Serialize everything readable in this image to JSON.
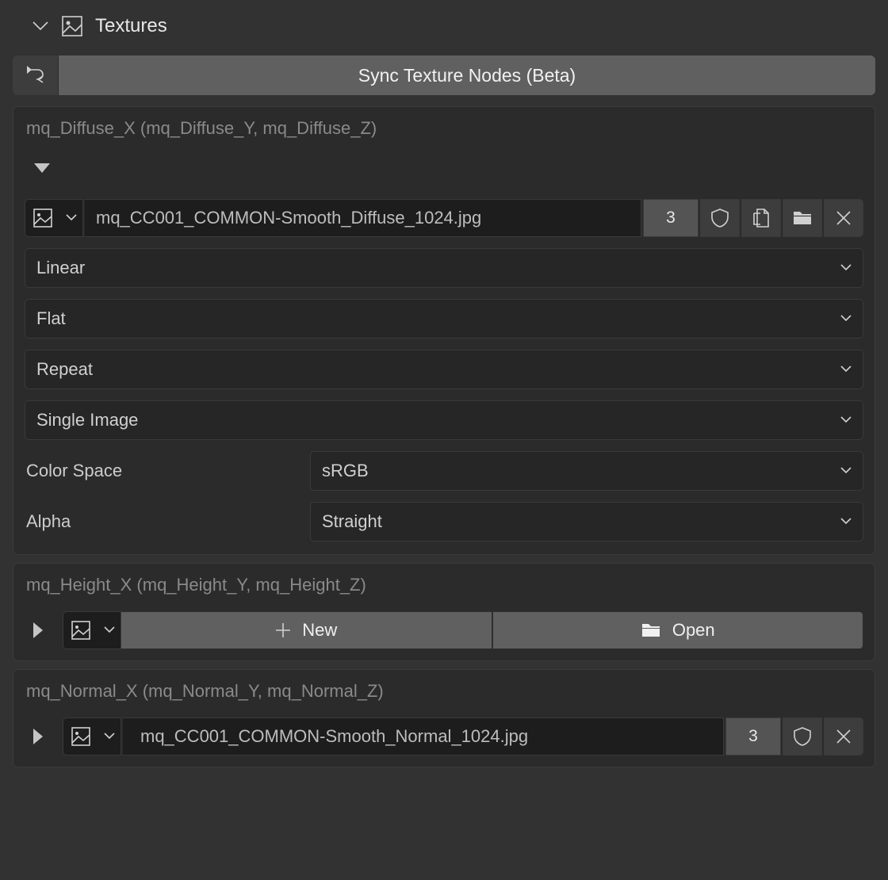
{
  "panel": {
    "title": "Textures"
  },
  "sync": {
    "label": "Sync Texture Nodes (Beta)"
  },
  "diffuse": {
    "title": "mq_Diffuse_X (mq_Diffuse_Y, mq_Diffuse_Z)",
    "filename": "mq_CC001_COMMON-Smooth_Diffuse_1024.jpg",
    "users": "3",
    "interp": "Linear",
    "projection": "Flat",
    "extension": "Repeat",
    "source": "Single Image",
    "color_space_label": "Color Space",
    "color_space": "sRGB",
    "alpha_label": "Alpha",
    "alpha": "Straight"
  },
  "height": {
    "title": "mq_Height_X (mq_Height_Y, mq_Height_Z)",
    "new_label": "New",
    "open_label": "Open"
  },
  "normal": {
    "title": "mq_Normal_X (mq_Normal_Y, mq_Normal_Z)",
    "filename": "mq_CC001_COMMON-Smooth_Normal_1024.jpg",
    "users": "3"
  }
}
